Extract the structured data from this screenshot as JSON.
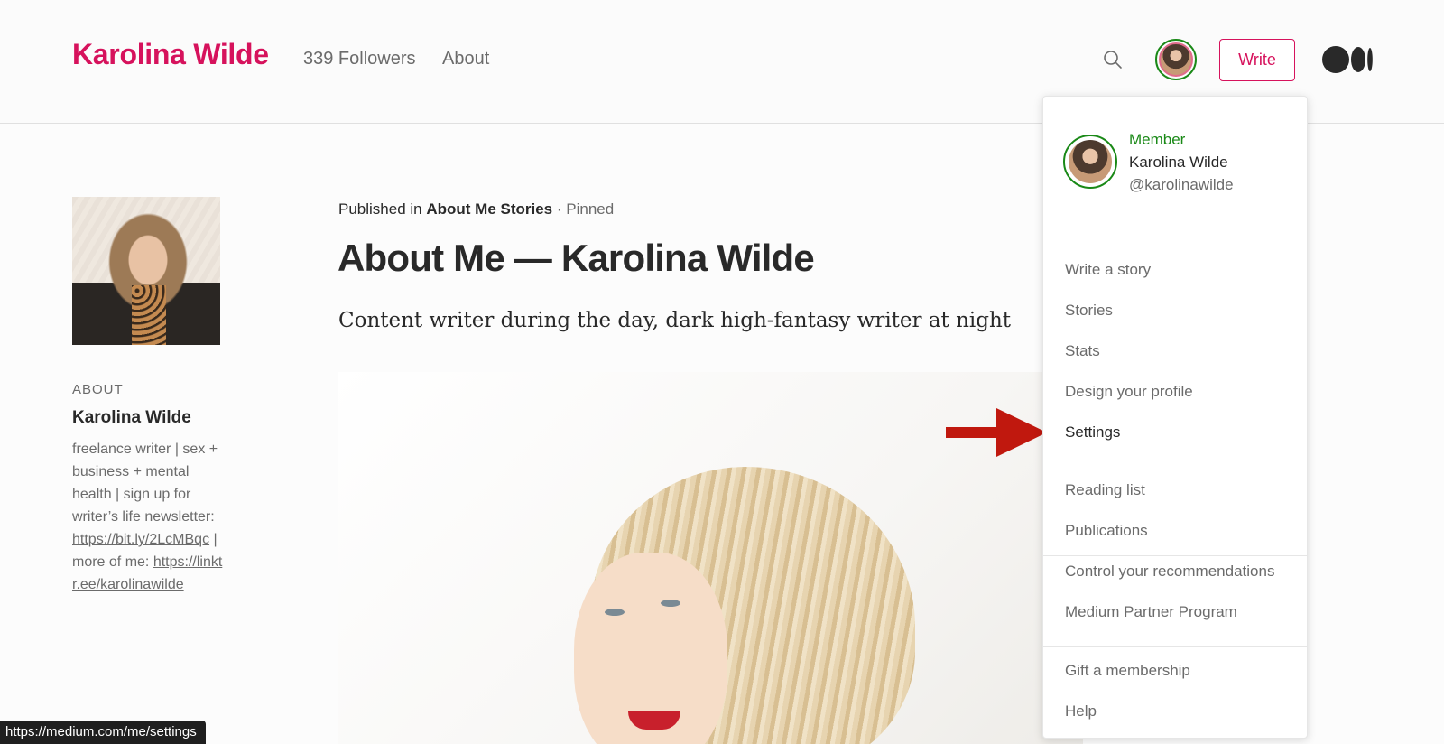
{
  "header": {
    "brand": "Karolina Wilde",
    "followers": "339 Followers",
    "about": "About",
    "write_label": "Write"
  },
  "colors": {
    "brand": "#d6125c",
    "member_green": "#1a8917",
    "arrow": "#c0180e"
  },
  "sidebar": {
    "about_heading": "ABOUT",
    "name": "Karolina Wilde",
    "bio_text": "freelance writer | sex + business + mental health | sign up for writer’s life newsletter: ",
    "link1": "https://bit.ly/2LcMBqc",
    "bio_mid": " | more of me: ",
    "link2": "https://linktr.ee/karolinawilde"
  },
  "article": {
    "published_prefix": "Published in ",
    "publication": "About Me Stories",
    "pinned": " · Pinned",
    "title": "About Me — Karolina Wilde",
    "subtitle": "Content writer during the day, dark high-fantasy writer at night"
  },
  "dropdown": {
    "member_label": "Member",
    "name": "Karolina Wilde",
    "handle": "@karolinawilde",
    "group1": [
      "Write a story",
      "Stories",
      "Stats",
      "Design your profile",
      "Settings"
    ],
    "group2": [
      "Reading list",
      "Publications",
      "Control your recommendations",
      "Medium Partner Program"
    ],
    "group3": [
      "Gift a membership",
      "Help"
    ]
  },
  "status_bar": {
    "url": "https://medium.com/me/settings"
  }
}
